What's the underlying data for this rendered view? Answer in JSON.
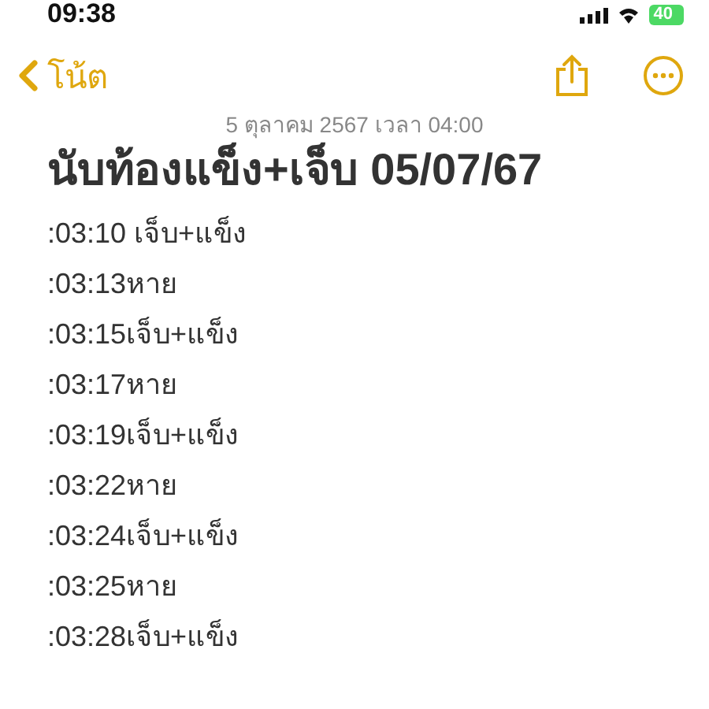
{
  "status_bar": {
    "time": "09:38",
    "battery": "40"
  },
  "nav": {
    "back_label": "โน้ต"
  },
  "note": {
    "date": "5 ตุลาคม 2567 เวลา 04:00",
    "title": "นับท้องแข็ง+เจ็บ 05/07/67",
    "lines": [
      ":03:10 เจ็บ+แข็ง",
      ":03:13หาย",
      ":03:15เจ็บ+แข็ง",
      ":03:17หาย",
      ":03:19เจ็บ+แข็ง",
      ":03:22หาย",
      ":03:24เจ็บ+แข็ง",
      ":03:25หาย",
      ":03:28เจ็บ+แข็ง"
    ]
  }
}
